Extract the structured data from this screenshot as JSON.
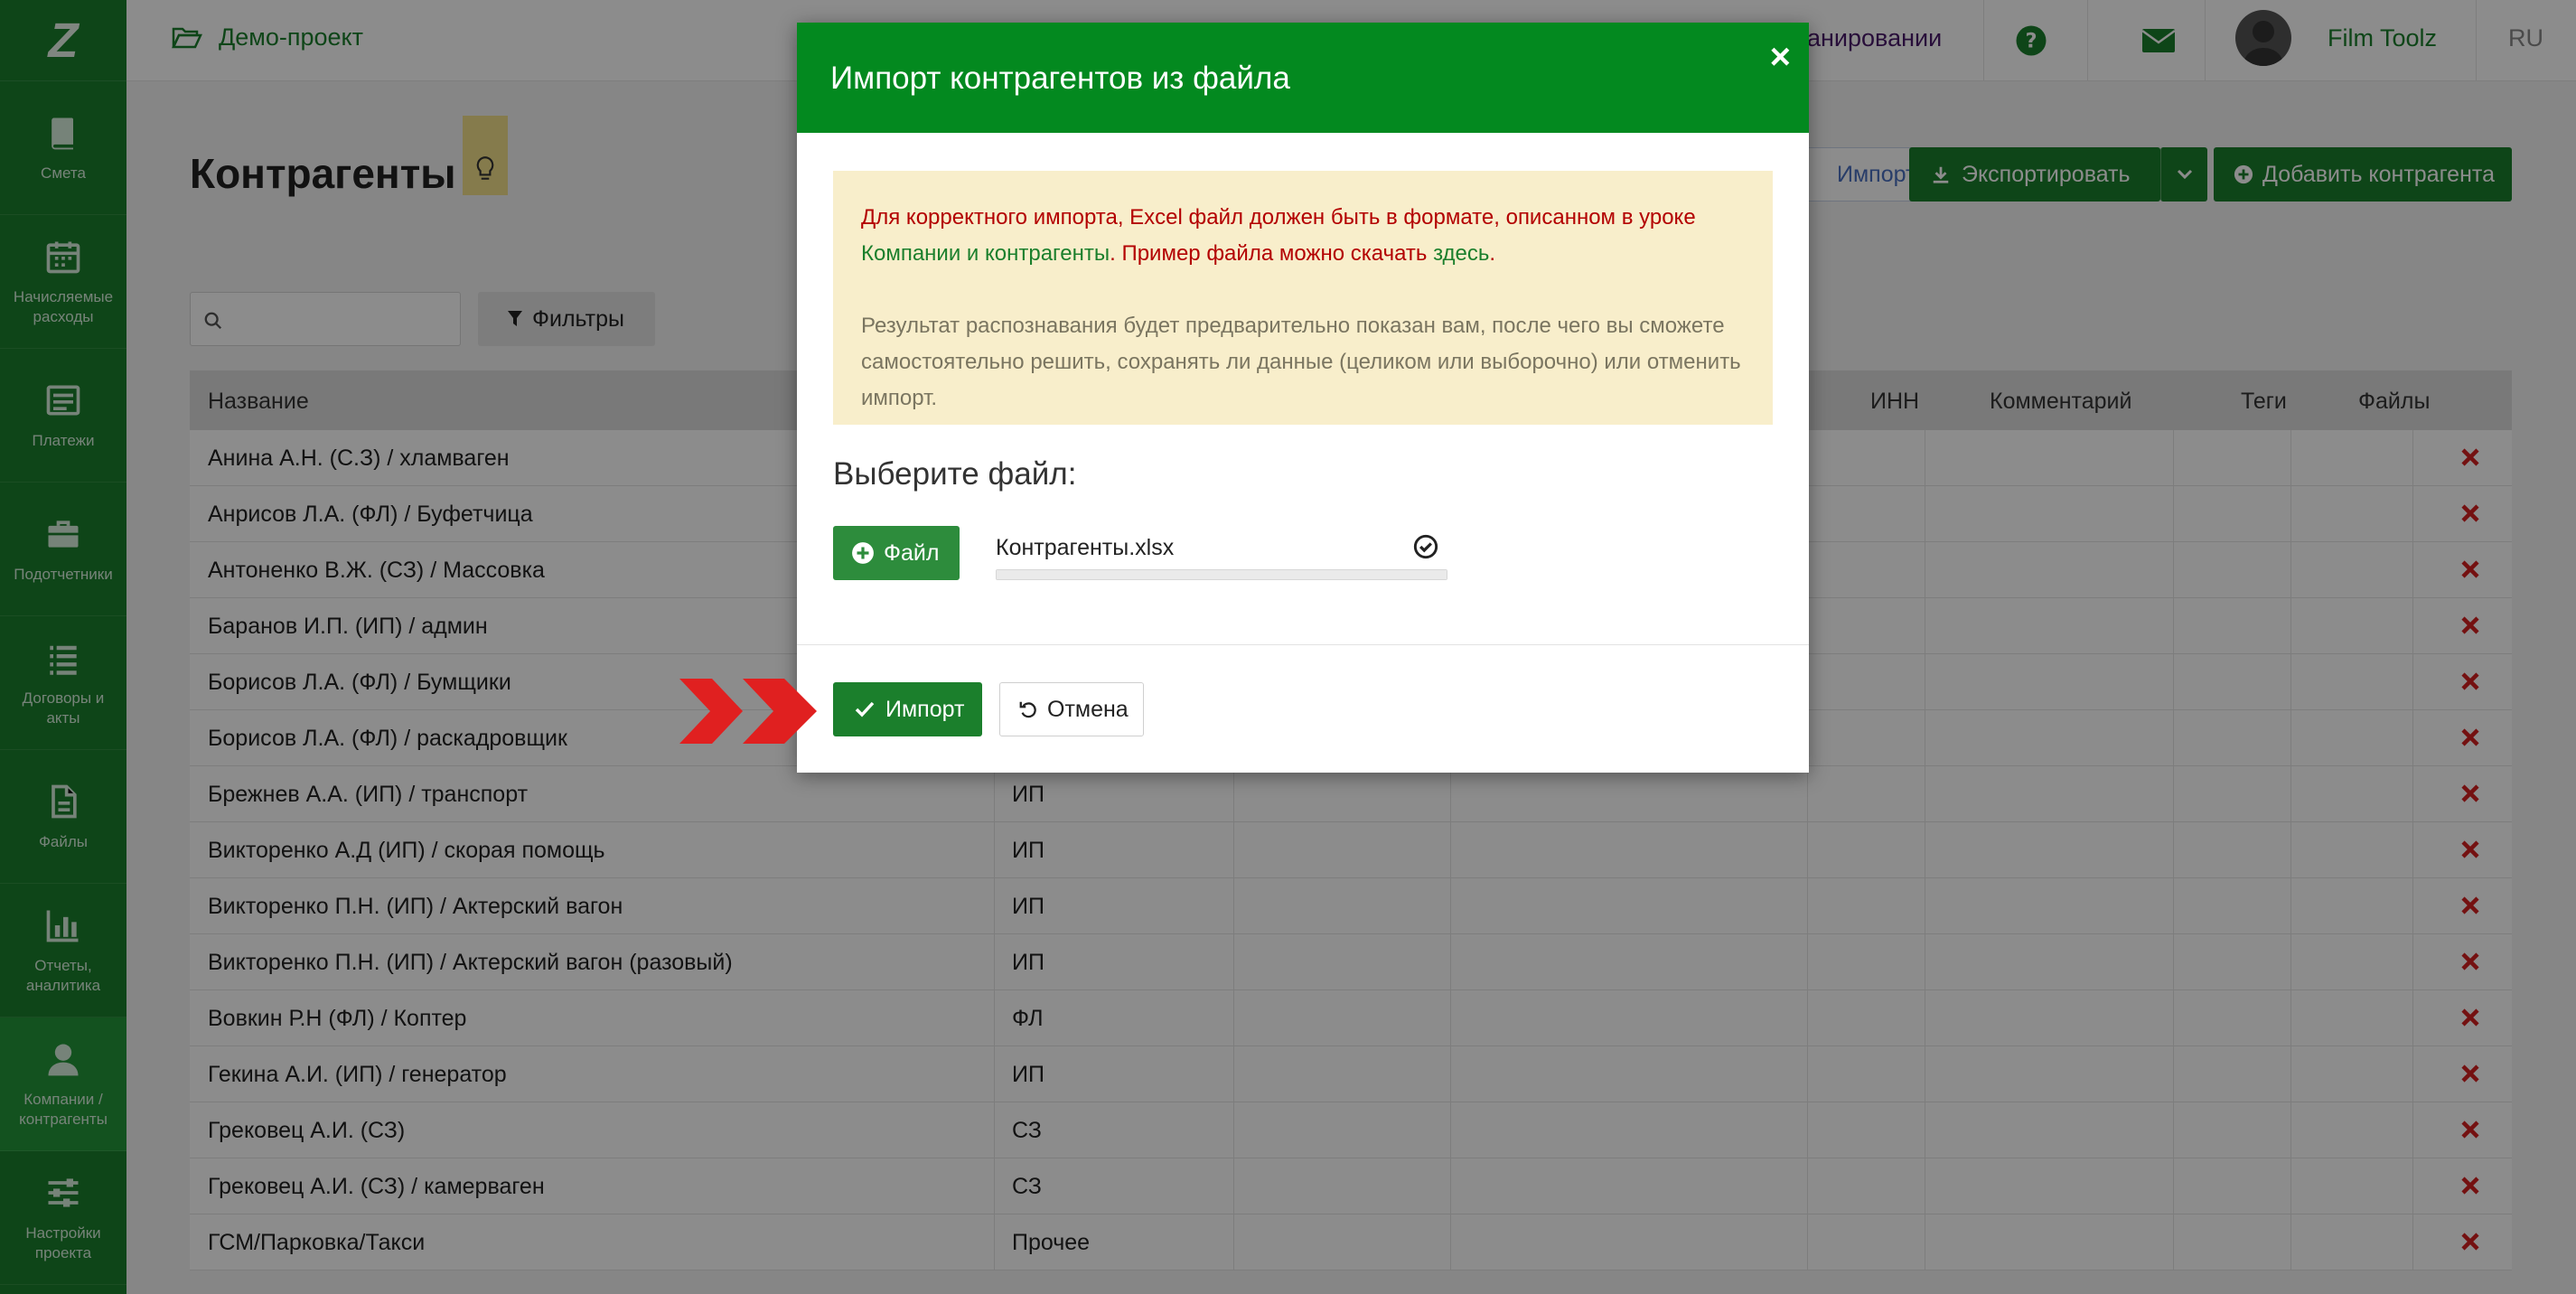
{
  "sidebar": {
    "logo": "Z",
    "items": [
      {
        "label": "Смета",
        "icon": "book-icon"
      },
      {
        "label": "Начисляемые\nрасходы",
        "icon": "calendar-icon"
      },
      {
        "label": "Платежи",
        "icon": "list-box-icon"
      },
      {
        "label": "Подотчетники",
        "icon": "briefcase-icon"
      },
      {
        "label": "Договоры и\nакты",
        "icon": "list-icon"
      },
      {
        "label": "Файлы",
        "icon": "file-icon"
      },
      {
        "label": "Отчеты,\nаналитика",
        "icon": "bar-chart-icon"
      },
      {
        "label": "Компании /\nконтрагенты",
        "icon": "user-icon",
        "active": true
      },
      {
        "label": "Настройки\nпроекта",
        "icon": "sliders-icon"
      }
    ]
  },
  "topbar": {
    "project": "Демо-проект",
    "plan_link": "анировании",
    "user": "Film Toolz",
    "lang": "RU"
  },
  "page": {
    "title": "Контрагенты",
    "import_label": "Импорт",
    "export_label": "Экспортировать",
    "add_label": "Добавить контрагента",
    "filters_label": "Фильтры",
    "search_placeholder": ""
  },
  "table": {
    "columns": [
      "Название",
      "ИНН",
      "Комментарий",
      "Теги",
      "Файлы"
    ],
    "rows": [
      {
        "name": "Анина А.Н. (С.З) / хламваген",
        "type": ""
      },
      {
        "name": "Анрисов Л.А. (ФЛ) / Буфетчица",
        "type": ""
      },
      {
        "name": "Антоненко В.Ж. (СЗ) / Массовка",
        "type": ""
      },
      {
        "name": "Баранов И.П. (ИП) / админ",
        "type": ""
      },
      {
        "name": "Борисов Л.А. (ФЛ) / Бумщики",
        "type": ""
      },
      {
        "name": "Борисов Л.А. (ФЛ) / раскадровщик",
        "type": ""
      },
      {
        "name": "Брежнев А.А. (ИП) / транспорт",
        "type": "ИП"
      },
      {
        "name": "Викторенко А.Д (ИП) / скорая помощь",
        "type": "ИП"
      },
      {
        "name": "Викторенко П.Н. (ИП) / Актерский вагон",
        "type": "ИП"
      },
      {
        "name": "Викторенко П.Н. (ИП) / Актерский вагон (разовый)",
        "type": "ИП"
      },
      {
        "name": "Вовкин Р.Н (ФЛ) / Коптер",
        "type": "ФЛ"
      },
      {
        "name": "Гекина А.И. (ИП) / генератор",
        "type": "ИП"
      },
      {
        "name": "Грековец А.И. (СЗ)",
        "type": "СЗ"
      },
      {
        "name": "Грековец А.И. (СЗ) / камерваген",
        "type": "СЗ"
      },
      {
        "name": "ГСМ/Парковка/Такси",
        "type": "Прочее"
      }
    ]
  },
  "modal": {
    "title": "Импорт контрагентов из файла",
    "close": "×",
    "notice_part1": "Для корректного импорта, Excel файл должен быть в формате, описанном в уроке ",
    "notice_link1": "Компании и контрагенты",
    "notice_part2": ". Пример файла можно скачать ",
    "notice_link2": "здесь",
    "notice_part3": ".",
    "notice_text2": "Результат распознавания будет предварительно показан вам, после чего вы сможете самостоятельно решить, сохранять ли данные (целиком или выборочно) или отменить импорт.",
    "choose_label": "Выберите файл:",
    "file_button": "Файл",
    "file_name": "Контрагенты.xlsx",
    "upload_progress": 1.0,
    "import_button": "Импорт",
    "cancel_button": "Отмена"
  },
  "colors": {
    "brand_green": "#03891f",
    "sidebar": "#1b7f2c",
    "notice_bg": "#f8eecb",
    "error_red": "#b30000",
    "arrow_red": "#e02020"
  }
}
